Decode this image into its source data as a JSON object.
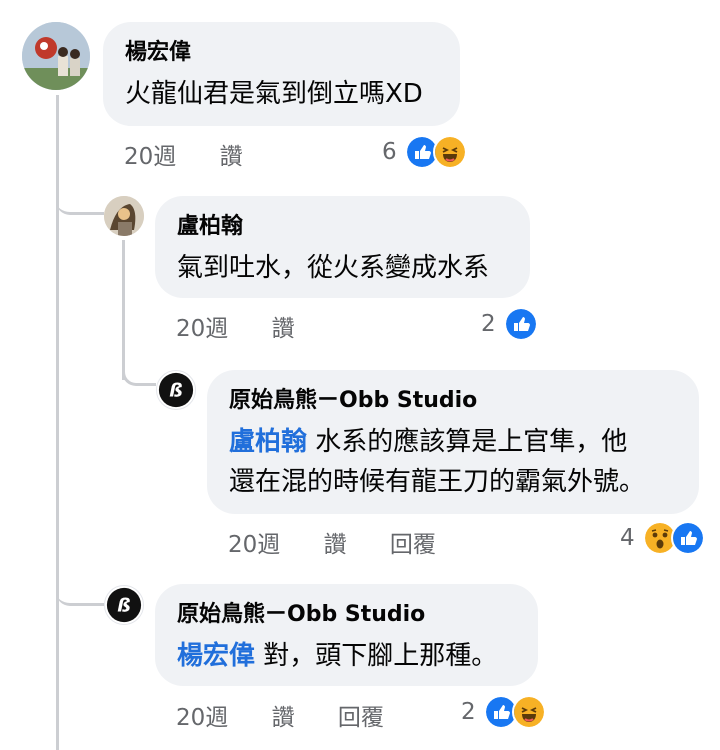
{
  "comments": [
    {
      "author": "楊宏偉",
      "text": "火龍仙君是氣到倒立嗎XD",
      "time": "20週",
      "like_label": "讚",
      "reaction_count": "6",
      "reactions": [
        "like-icon",
        "haha-icon"
      ]
    },
    {
      "author": "盧柏翰",
      "text": "氣到吐水，從火系變成水系",
      "time": "20週",
      "like_label": "讚",
      "reaction_count": "2",
      "reactions": [
        "like-icon"
      ]
    },
    {
      "author": "原始鳥熊ㄧObb Studio",
      "mention": "盧柏翰",
      "text_line1": "水系的應該算是上官隼，他",
      "text_line2": "還在混的時候有龍王刀的霸氣外號。",
      "time": "20週",
      "like_label": "讚",
      "reply_label": "回覆",
      "reaction_count": "4",
      "reactions": [
        "wow-icon",
        "like-icon"
      ]
    },
    {
      "author": "原始鳥熊ㄧObb Studio",
      "mention": "楊宏偉",
      "text": "對，頭下腳上那種。",
      "time": "20週",
      "like_label": "讚",
      "reply_label": "回覆",
      "reaction_count": "2",
      "reactions": [
        "like-icon",
        "haha-icon"
      ]
    }
  ],
  "colors": {
    "bubble": "#f0f2f5",
    "mention": "#216fdb",
    "meta": "#65676b",
    "thread_line": "#ccced2",
    "like_blue": "#1877f2",
    "haha_yellow": "#f7b125"
  }
}
